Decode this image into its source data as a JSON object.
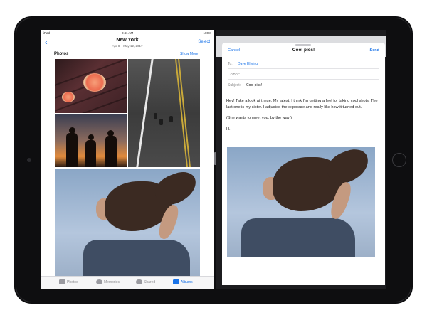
{
  "photos_app": {
    "status": {
      "carrier": "iPad",
      "time": "9:41 AM",
      "battery": "100%"
    },
    "nav": {
      "back_glyph": "‹",
      "title": "New York",
      "subtitle": "Apr 8 – May 12, 2017",
      "select_label": "Select"
    },
    "section": {
      "title": "Photos",
      "show_more_label": "Show More"
    },
    "photos": [
      {
        "label": "grapefruit-on-table"
      },
      {
        "label": "aerial-road-people"
      },
      {
        "label": "sunset-silhouettes"
      },
      {
        "label": "woman-hair-wind"
      }
    ],
    "tabs": [
      {
        "label": "Photos",
        "icon": "photos-tab-icon",
        "active": false
      },
      {
        "label": "Memories",
        "icon": "memories-tab-icon",
        "active": false
      },
      {
        "label": "Shared",
        "icon": "cloud-icon",
        "active": false
      },
      {
        "label": "Albums",
        "icon": "folder-icon",
        "active": true
      }
    ]
  },
  "mail_app": {
    "compose": {
      "cancel_label": "Cancel",
      "title": "Cool pics!",
      "send_label": "Send",
      "to_label": "To:",
      "to_value": "Dave Elfving",
      "cc_label": "Cc/Bcc:",
      "subject_label": "Subject:",
      "subject_value": "Cool pics!",
      "body": [
        "Hey! Take a look at these. My latest. I think I'm getting a feel for taking cool shots. The last one is my sister. I adjusted the exposure and really like how it turned out.",
        "(She wants to meet you, by the way!)",
        "H."
      ]
    }
  },
  "colors": {
    "accent": "#1a73e8",
    "bezel": "#0e0e10"
  }
}
